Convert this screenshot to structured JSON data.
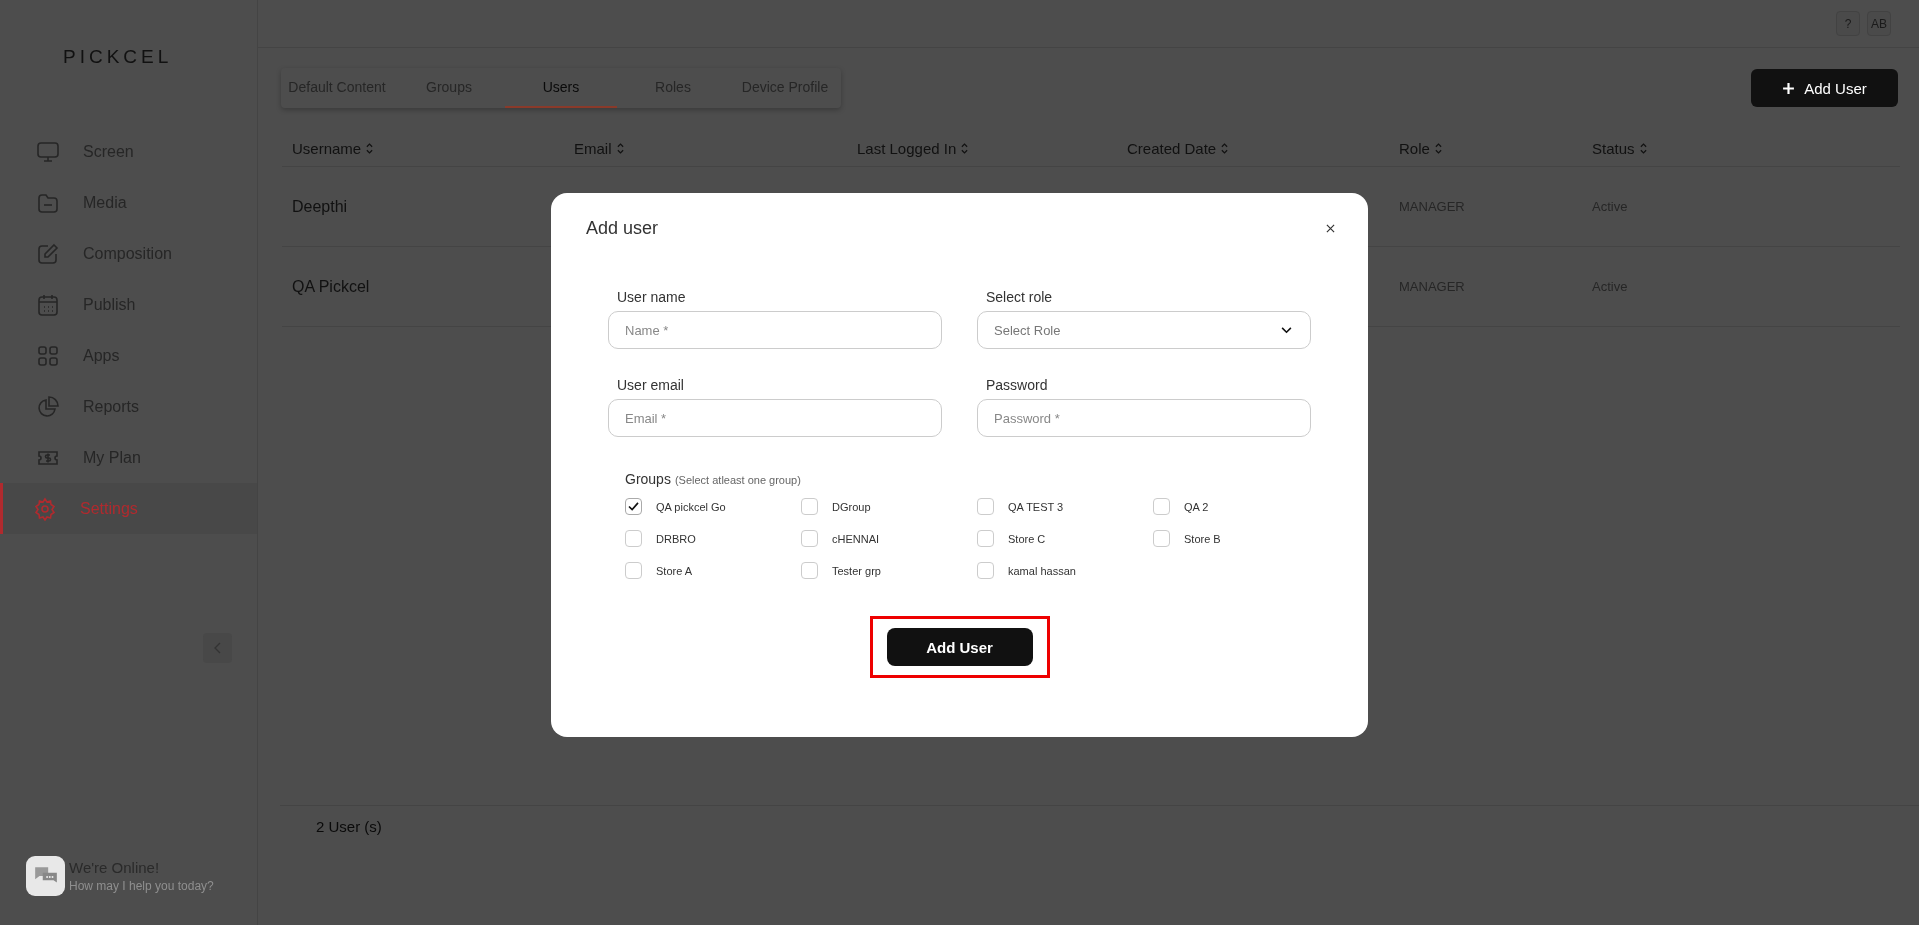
{
  "sidebar": {
    "logo": "PICKCEL",
    "items": [
      {
        "label": "Screen",
        "selected": false
      },
      {
        "label": "Media",
        "selected": false
      },
      {
        "label": "Composition",
        "selected": false
      },
      {
        "label": "Publish",
        "selected": false
      },
      {
        "label": "Apps",
        "selected": false
      },
      {
        "label": "Reports",
        "selected": false
      },
      {
        "label": "My Plan",
        "selected": false
      },
      {
        "label": "Settings",
        "selected": true
      }
    ]
  },
  "chat": {
    "title": "We're Online!",
    "subtitle": "How may I help you today?"
  },
  "topbar": {
    "help": "?",
    "avatar": "AB"
  },
  "tabs": [
    {
      "label": "Default Content",
      "selected": false
    },
    {
      "label": "Groups",
      "selected": false
    },
    {
      "label": "Users",
      "selected": true
    },
    {
      "label": "Roles",
      "selected": false
    },
    {
      "label": "Device Profile",
      "selected": false
    }
  ],
  "add_user_button": "Add User",
  "table": {
    "columns": [
      "Username",
      "Email",
      "Last Logged In",
      "Created Date",
      "Role",
      "Status"
    ],
    "rows": [
      {
        "username": "Deepthi",
        "role": "MANAGER",
        "status": "Active"
      },
      {
        "username": "QA Pickcel",
        "role": "MANAGER",
        "status": "Active"
      }
    ],
    "footer": "2 User (s)"
  },
  "modal": {
    "title": "Add user",
    "fields": [
      {
        "kind": "text",
        "label": "User name",
        "placeholder": "Name *"
      },
      {
        "kind": "select",
        "label": "Select role",
        "placeholder": "Select Role"
      },
      {
        "kind": "text",
        "label": "User email",
        "placeholder": "Email *"
      },
      {
        "kind": "password",
        "label": "Password",
        "placeholder": "Password *"
      }
    ],
    "groups": {
      "label": "Groups",
      "hint": "(Select atleast one group)",
      "items": [
        {
          "label": "QA pickcel Go",
          "checked": true
        },
        {
          "label": "DGroup",
          "checked": false
        },
        {
          "label": "QA TEST 3",
          "checked": false
        },
        {
          "label": "QA 2",
          "checked": false
        },
        {
          "label": "DRBRO",
          "checked": false
        },
        {
          "label": "cHENNAI",
          "checked": false
        },
        {
          "label": "Store C",
          "checked": false
        },
        {
          "label": "Store B",
          "checked": false
        },
        {
          "label": "Store A",
          "checked": false
        },
        {
          "label": "Tester grp",
          "checked": false
        },
        {
          "label": "kamal hassan",
          "checked": false
        }
      ]
    },
    "submit": "Add User"
  }
}
